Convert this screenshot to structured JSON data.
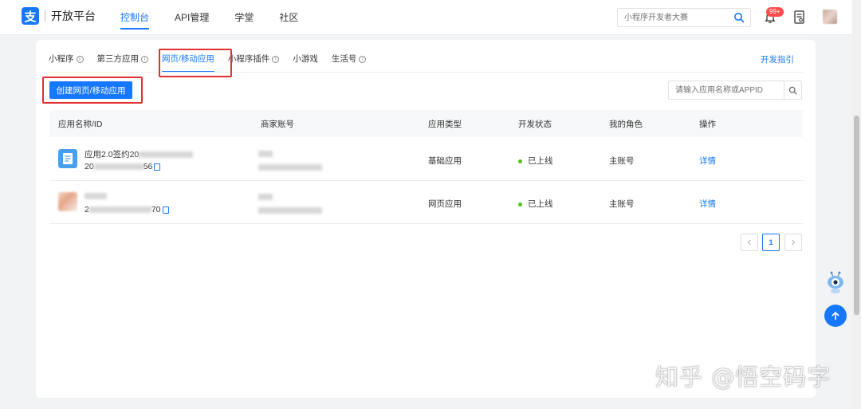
{
  "brand": {
    "logo_glyph": "支",
    "name": "开放平台",
    "color": "#1677ff"
  },
  "nav": [
    {
      "label": "控制台",
      "active": true
    },
    {
      "label": "API管理",
      "active": false
    },
    {
      "label": "学堂",
      "active": false
    },
    {
      "label": "社区",
      "active": false
    }
  ],
  "header_search": {
    "placeholder": "小程序开发者大赛"
  },
  "notifications": {
    "badge": "99+"
  },
  "tabs": [
    {
      "label": "小程序",
      "info": true,
      "active": false
    },
    {
      "label": "第三方应用",
      "info": true,
      "active": false
    },
    {
      "label": "网页/移动应用",
      "info": false,
      "active": true
    },
    {
      "label": "小程序插件",
      "info": true,
      "active": false
    },
    {
      "label": "小游戏",
      "info": false,
      "active": false
    },
    {
      "label": "生活号",
      "info": true,
      "active": false
    }
  ],
  "dev_guide": "开发指引",
  "create_button": "创建网页/移动应用",
  "app_search": {
    "placeholder": "请输入应用名称或APPID"
  },
  "table": {
    "columns": [
      "应用名称/ID",
      "商家账号",
      "应用类型",
      "开发状态",
      "我的角色",
      "操作"
    ],
    "rows": [
      {
        "name_prefix": "应用2.0签约20",
        "id_prefix": "20",
        "id_suffix": "56",
        "type": "基础应用",
        "status": "已上线",
        "role": "主账号",
        "action": "详情"
      },
      {
        "name_prefix": "",
        "id_prefix": "2",
        "id_suffix": "70",
        "type": "网页应用",
        "status": "已上线",
        "role": "主账号",
        "action": "详情"
      }
    ]
  },
  "pagination": {
    "current": "1"
  },
  "watermark": "知乎 @悟空码字"
}
